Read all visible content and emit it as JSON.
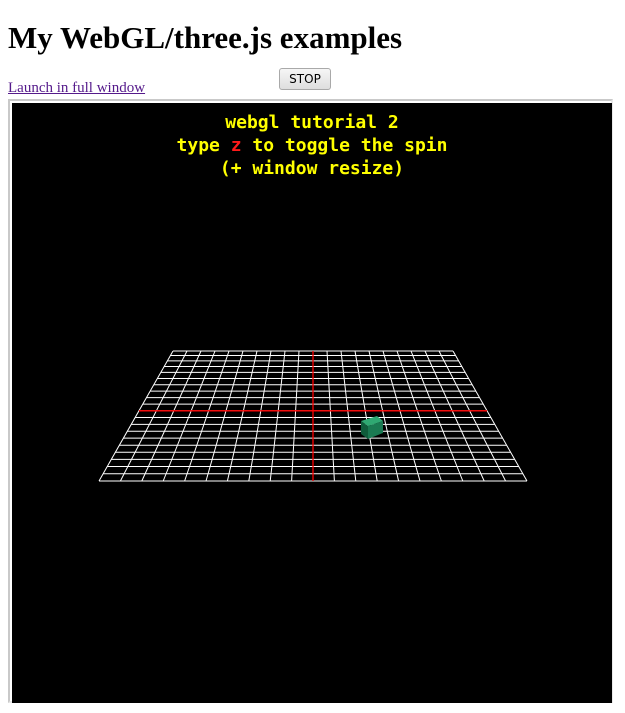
{
  "page": {
    "title": "My WebGL/three.js examples",
    "launch_link": "Launch in full window",
    "stop_button": "STOP"
  },
  "overlay": {
    "line1": "webgl tutorial 2",
    "line2_prefix": "type ",
    "line2_key": "z",
    "line2_suffix": " to toggle the spin",
    "line3": "(+ window resize)"
  },
  "scene": {
    "background": "#000000",
    "grid_color": "#ffffff",
    "axis_color": "#ff0000",
    "cube_color": "#1a7a52",
    "text_color": "#ffff00",
    "key_color": "#ff1a1a",
    "grid_cells": 20
  }
}
